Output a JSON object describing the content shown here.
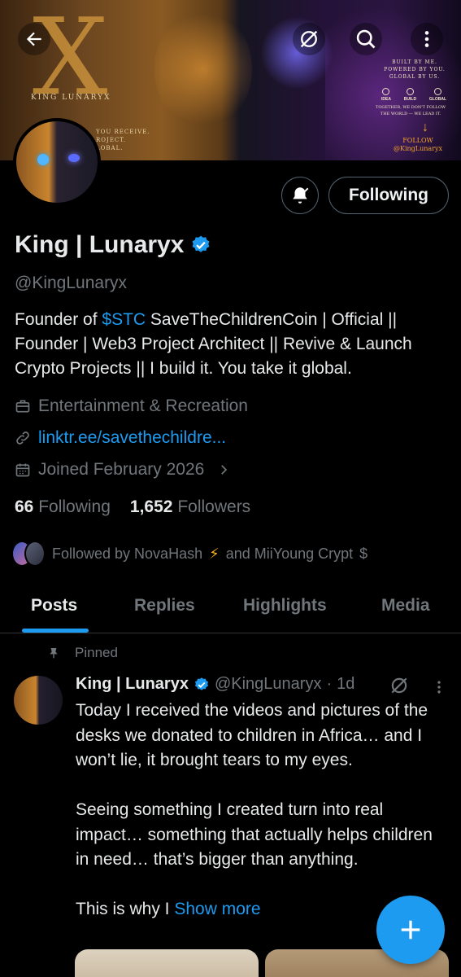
{
  "banner": {
    "brand": "KING LUNARYX",
    "left_small_lines": [
      "YOU RECEIVE.",
      "ROJECT.",
      "LOBAL."
    ],
    "right_text_lines": [
      "BUILT BY ME.",
      "POWERED BY YOU.",
      "GLOBAL BY US."
    ],
    "right_icons": [
      "IDEA",
      "BUILD",
      "GLOBAL"
    ],
    "tagline_lines": [
      "TOGETHER, WE DON'T FOLLOW",
      "THE WORLD — WE LEAD IT."
    ],
    "follow_lines": [
      "FOLLOW",
      "@KingLunaryx"
    ]
  },
  "profile": {
    "following_button": "Following",
    "name": "King | Lunaryx",
    "handle": "@KingLunaryx",
    "bio_part1": "Founder of ",
    "bio_cashtag": "$STC",
    "bio_part2": " SaveTheChildrenCoin | Official || Founder | Web3 Project Architect || Revive & Launch Crypto Projects || I build it. You take it global.",
    "category": "Entertainment & Recreation",
    "link": "linktr.ee/savethechildre...",
    "joined": "Joined February 2026",
    "following_count": "66",
    "following_label": "Following",
    "followers_count": "1,652",
    "followers_label": "Followers",
    "followed_by_prefix": "Followed by NovaHash",
    "followed_by_suffix": "and MiiYoung Crypt"
  },
  "tabs": [
    "Posts",
    "Replies",
    "Highlights",
    "Media"
  ],
  "post": {
    "pinned_label": "Pinned",
    "author_name": "King | Lunaryx",
    "author_handle": "@KingLunaryx",
    "dot": "·",
    "time": "1d",
    "text": "Today I received the videos and pictures of the desks we donated to children in Africa… and I won’t lie, it brought tears to my eyes.\n\nSeeing something I created turn into real impact… something that actually helps children in need… that’s bigger than anything.\n\nThis is why I ",
    "show_more": "Show more"
  },
  "colors": {
    "accent": "#1d9bf0",
    "background": "#000000",
    "text_primary": "#e7e9ea",
    "text_secondary": "#71767b",
    "border": "#2f3336"
  }
}
